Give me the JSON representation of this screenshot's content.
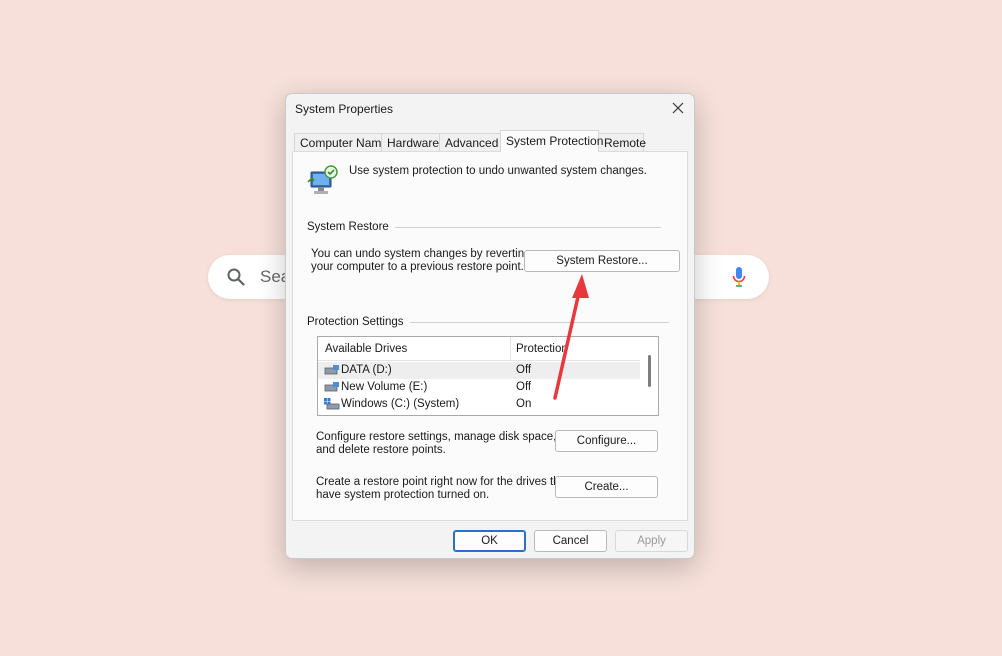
{
  "background": {
    "search_text": "Sea"
  },
  "dialog": {
    "title": "System Properties",
    "tabs": [
      {
        "label": "Computer Name"
      },
      {
        "label": "Hardware"
      },
      {
        "label": "Advanced"
      },
      {
        "label": "System Protection"
      },
      {
        "label": "Remote"
      }
    ],
    "active_tab": "System Protection",
    "intro_text": "Use system protection to undo unwanted system changes.",
    "system_restore": {
      "group_label": "System Restore",
      "description_line1": "You can undo system changes by reverting",
      "description_line2": "your computer to a previous restore point.",
      "button_label": "System Restore..."
    },
    "protection_settings": {
      "group_label": "Protection Settings",
      "columns": [
        "Available Drives",
        "Protection"
      ],
      "drives": [
        {
          "name": "DATA (D:)",
          "protection": "Off"
        },
        {
          "name": "New Volume (E:)",
          "protection": "Off"
        },
        {
          "name": "Windows (C:) (System)",
          "protection": "On"
        }
      ],
      "configure_text_line1": "Configure restore settings, manage disk space,",
      "configure_text_line2": "and delete restore points.",
      "configure_button": "Configure...",
      "create_text_line1": "Create a restore point right now for the drives that",
      "create_text_line2": "have system protection turned on.",
      "create_button": "Create..."
    },
    "footer": {
      "ok": "OK",
      "cancel": "Cancel",
      "apply": "Apply"
    }
  },
  "colors": {
    "background": "#f6e0d9",
    "annotation_arrow": "#e8383d",
    "primary_border": "#2e6fc2"
  }
}
